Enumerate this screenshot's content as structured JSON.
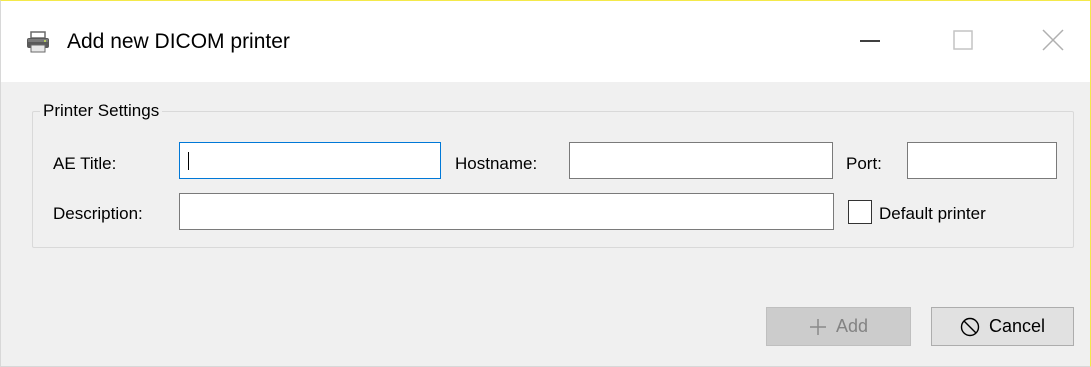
{
  "window": {
    "title": "Add new DICOM printer",
    "icon": "printer-icon",
    "controls": [
      "minimize-icon",
      "maximize-icon",
      "close-icon"
    ]
  },
  "group": {
    "legend": "Printer Settings"
  },
  "fields": {
    "ae_title": {
      "label": "AE Title:",
      "value": ""
    },
    "hostname": {
      "label": "Hostname:",
      "value": ""
    },
    "port": {
      "label": "Port:",
      "value": ""
    },
    "description": {
      "label": "Description:",
      "value": ""
    }
  },
  "default_printer": {
    "label": "Default printer",
    "checked": false
  },
  "buttons": {
    "add": {
      "label": "Add",
      "icon": "plus-icon",
      "enabled": false
    },
    "cancel": {
      "label": "Cancel",
      "icon": "cancel-icon",
      "enabled": true
    }
  },
  "colors": {
    "focus": "#0078d7",
    "window_bg": "#f0f0f0",
    "title_bar_bg": "#ffffff",
    "window_border_active": "#f4e94a"
  }
}
